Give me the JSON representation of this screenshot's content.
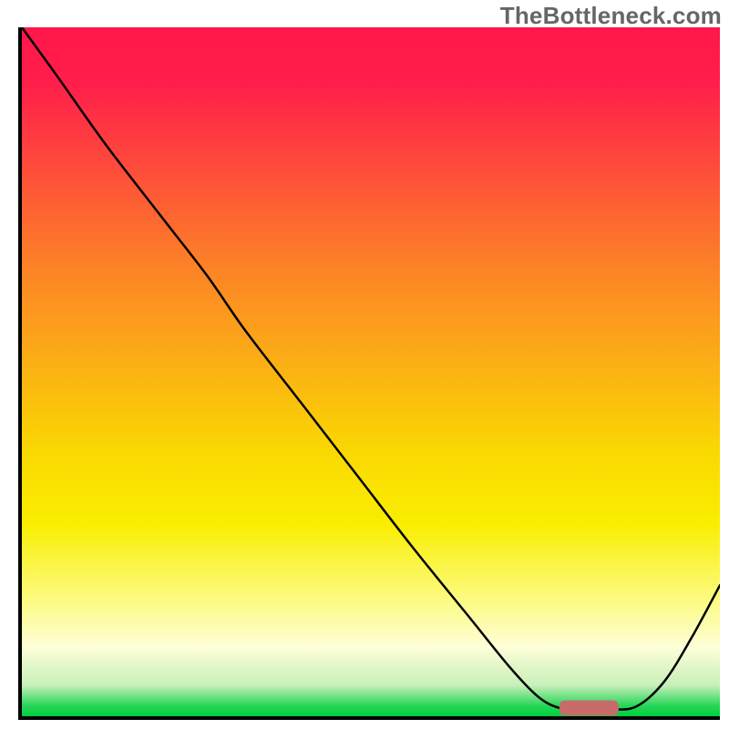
{
  "watermark": "TheBottleneck.com",
  "chart_data": {
    "type": "line",
    "title": "",
    "xlabel": "",
    "ylabel": "",
    "xlim": [
      0,
      100
    ],
    "ylim": [
      0,
      100
    ],
    "grid": false,
    "background_gradient": [
      {
        "stop": 0.0,
        "color": "#ff1749"
      },
      {
        "stop": 0.08,
        "color": "#ff1e4b"
      },
      {
        "stop": 0.2,
        "color": "#fe4a3b"
      },
      {
        "stop": 0.35,
        "color": "#fc8326"
      },
      {
        "stop": 0.5,
        "color": "#fbb313"
      },
      {
        "stop": 0.62,
        "color": "#fad902"
      },
      {
        "stop": 0.72,
        "color": "#f9ee00"
      },
      {
        "stop": 0.83,
        "color": "#fcfb81"
      },
      {
        "stop": 0.9,
        "color": "#fefed8"
      },
      {
        "stop": 0.955,
        "color": "#c7f0ba"
      },
      {
        "stop": 0.985,
        "color": "#26d557"
      },
      {
        "stop": 1.0,
        "color": "#00cf3e"
      }
    ],
    "series": [
      {
        "name": "bottleneck-curve",
        "color": "#000000",
        "stroke_width": 2.5,
        "x": [
          0,
          5,
          12,
          20,
          26.5,
          32,
          40,
          48,
          56,
          64,
          70,
          74,
          77,
          80,
          84,
          88,
          92,
          96,
          100
        ],
        "y": [
          100,
          93,
          83,
          72.5,
          64,
          56,
          45.5,
          35,
          24.5,
          14.5,
          7,
          2.8,
          1.2,
          1.0,
          1.0,
          1.4,
          5,
          11.5,
          19
        ]
      }
    ],
    "marker": {
      "name": "optimal-range-marker",
      "color": "#c86a6a",
      "x_start": 77,
      "x_end": 85.5,
      "y": 1.2,
      "thickness": 2.2
    }
  }
}
